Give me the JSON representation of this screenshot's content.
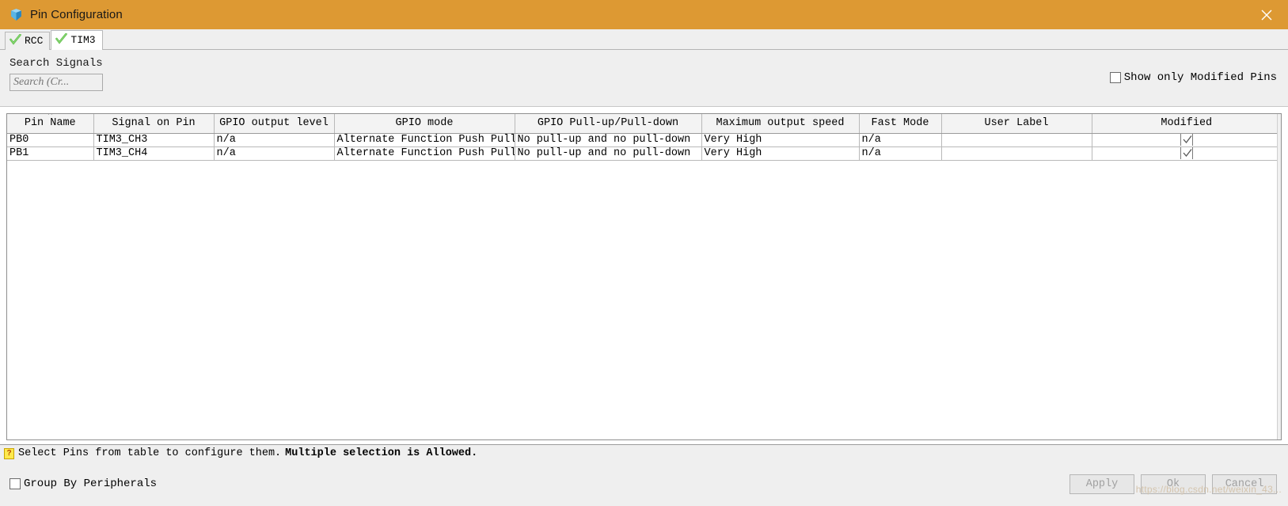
{
  "window": {
    "title": "Pin Configuration",
    "icon": "cube-icon",
    "close_icon": "close-icon",
    "titlebar_color": "#dd9933"
  },
  "tabs": [
    {
      "label": "RCC",
      "icon": "green-check-icon",
      "active": false
    },
    {
      "label": "TIM3",
      "icon": "green-check-icon",
      "active": true
    }
  ],
  "search": {
    "label": "Search Signals",
    "placeholder": "Search (Cr...",
    "value": ""
  },
  "show_modified": {
    "label": "Show only Modified Pins",
    "checked": false
  },
  "table": {
    "columns": [
      {
        "label": "Pin Name",
        "sorted": true,
        "sort_indicator": "⌃"
      },
      {
        "label": "Signal on Pin",
        "sorted": false
      },
      {
        "label": "GPIO output level",
        "sorted": false
      },
      {
        "label": "GPIO mode",
        "sorted": false
      },
      {
        "label": "GPIO Pull-up/Pull-down",
        "sorted": false
      },
      {
        "label": "Maximum output speed",
        "sorted": false
      },
      {
        "label": "Fast Mode",
        "sorted": false
      },
      {
        "label": "User Label",
        "sorted": false
      },
      {
        "label": "Modified",
        "sorted": false
      }
    ],
    "rows": [
      {
        "pin_name": "PB0",
        "signal_on_pin": "TIM3_CH3",
        "gpio_output_level": "n/a",
        "gpio_mode": "Alternate Function Push Pull",
        "gpio_pull": "No pull-up and no pull-down",
        "max_output_speed": "Very High",
        "fast_mode": "n/a",
        "user_label": "",
        "modified": true
      },
      {
        "pin_name": "PB1",
        "signal_on_pin": "TIM3_CH4",
        "gpio_output_level": "n/a",
        "gpio_mode": "Alternate Function Push Pull",
        "gpio_pull": "No pull-up and no pull-down",
        "max_output_speed": "Very High",
        "fast_mode": "n/a",
        "user_label": "",
        "modified": true
      }
    ]
  },
  "status": {
    "icon": "question-help-icon",
    "text": "Select Pins from table to configure them.",
    "emphasis": "Multiple selection is Allowed."
  },
  "bottom": {
    "group_by": {
      "label": "Group By Peripherals",
      "checked": false
    },
    "buttons": [
      {
        "label": "Apply",
        "enabled": false
      },
      {
        "label": "Ok",
        "enabled": false
      },
      {
        "label": "Cancel",
        "enabled": false
      }
    ]
  },
  "watermark": "https://blog.csdn.net/weixin_43..."
}
